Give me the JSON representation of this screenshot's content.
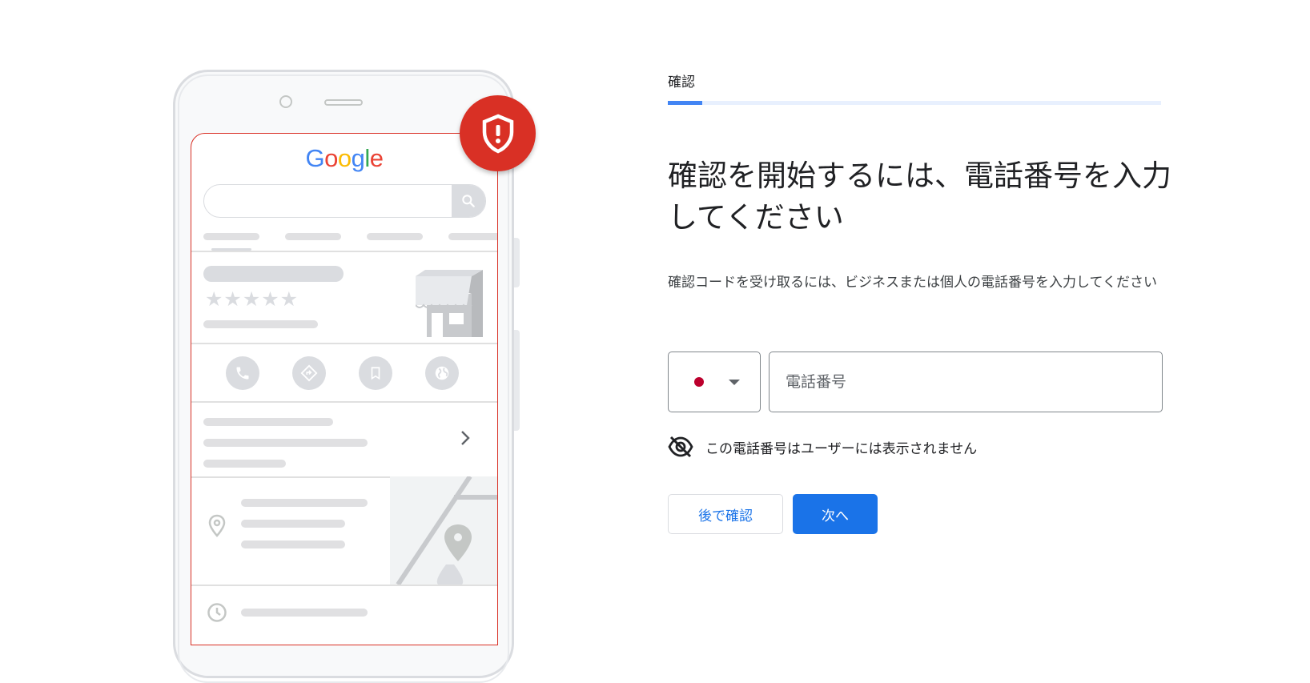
{
  "illustration": {
    "logo_text": "Google",
    "logo_letters": [
      "G",
      "o",
      "o",
      "g",
      "l",
      "e"
    ],
    "rating_stars": "★★★★★",
    "icons": [
      "search-icon",
      "phone-icon",
      "directions-icon",
      "bookmark-icon",
      "globe-icon",
      "chevron-right-icon",
      "location-pin-icon",
      "clock-icon",
      "shield-alert-icon",
      "storefront-icon"
    ],
    "colors": {
      "alert_red": "#d93025",
      "placeholder_gray": "#dadce0",
      "google_blue": "#4285f4",
      "google_red": "#ea4335",
      "google_yellow": "#fbbc05",
      "google_green": "#34a853"
    }
  },
  "step": {
    "label": "確認",
    "progress_fraction": 0.07
  },
  "main": {
    "heading": "確認を開始するには、電話番号を入力してください",
    "description": "確認コードを受け取るには、ビジネスまたは個人の電話番号を入力してください"
  },
  "form": {
    "country_flag": "japan-flag",
    "phone_placeholder": "電話番号",
    "phone_value": "",
    "privacy_note": "この電話番号はユーザーには表示されません"
  },
  "actions": {
    "later_label": "後で確認",
    "next_label": "次へ"
  },
  "colors": {
    "accent": "#1a73e8",
    "progress": "#4285f4",
    "progress_track": "#e8f0fe"
  }
}
